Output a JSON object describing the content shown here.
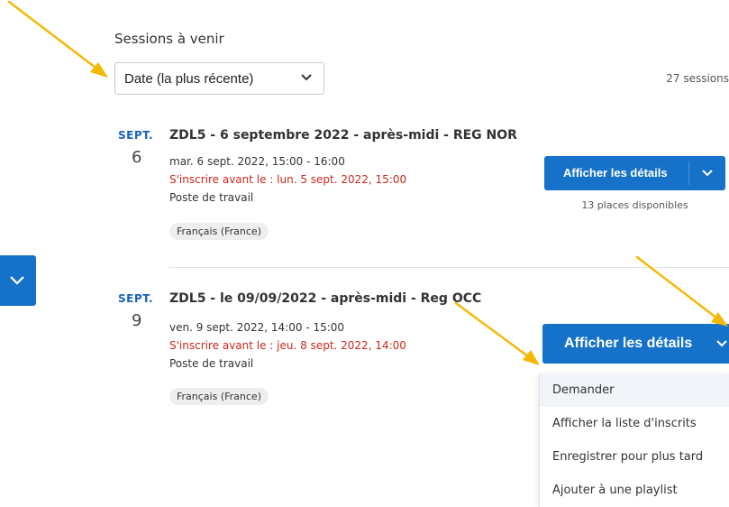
{
  "header": {
    "title": "Sessions à venir",
    "sort_value": "Date (la plus récente)",
    "count": "27 sessions"
  },
  "sessions": [
    {
      "month": "SEPT.",
      "day": "6",
      "title": "ZDL5 - 6 septembre 2022 - après-midi - REG NOR",
      "datetime": "mar. 6 sept. 2022, 15:00 - 16:00",
      "deadline": "S'inscrire avant le : lun. 5 sept. 2022, 15:00",
      "location": "Poste de travail",
      "language": "Français (France)",
      "button": "Afficher les détails",
      "availability": "13 places disponibles"
    },
    {
      "month": "SEPT.",
      "day": "9",
      "title": "ZDL5 - le 09/09/2022 - après-midi - Reg OCC",
      "datetime": "ven. 9 sept. 2022, 14:00 - 15:00",
      "deadline": "S'inscrire avant le : jeu. 8 sept. 2022, 14:00",
      "location": "Poste de travail",
      "language": "Français (France)",
      "button": "Afficher les détails"
    }
  ],
  "dropdown_menu": {
    "items": [
      "Demander",
      "Afficher la liste d'inscrits",
      "Enregistrer pour plus tard",
      "Ajouter à une playlist"
    ]
  },
  "colors": {
    "accent": "#1672c8",
    "month": "#1a63b7",
    "deadline": "#c8281e",
    "annotation_arrow": "#f5b800"
  },
  "icons": [
    "chevron-down-icon",
    "annotation-arrow"
  ]
}
